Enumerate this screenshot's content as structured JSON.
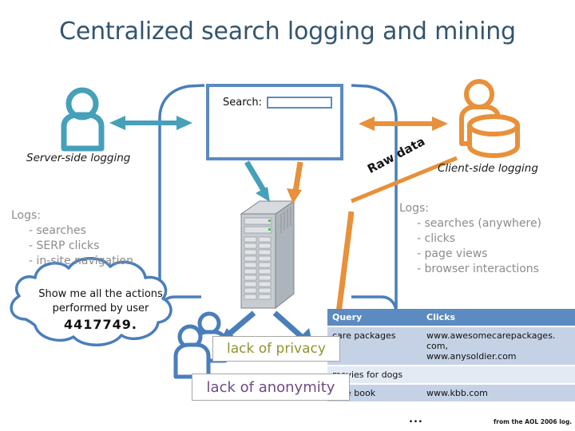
{
  "page": {
    "title": "Centralized search logging and mining",
    "background": "#ffffff",
    "title_color": "#33546e"
  },
  "browser": {
    "search_label": "Search:",
    "search_value": "",
    "search_placeholder": "",
    "border_color": "#5b8bc0"
  },
  "captions": {
    "server_side": "Server-side logging",
    "client_side": "Client-side logging",
    "raw_data": "Raw data"
  },
  "logs_left": {
    "heading": "Logs:",
    "items": [
      "- searches",
      "- SERP clicks",
      "- in-site navigation"
    ],
    "color": "#8c8c8c"
  },
  "logs_right": {
    "heading": "Logs:",
    "items": [
      "- searches (anywhere)",
      "- clicks",
      "- page views",
      "- browser interactions"
    ],
    "color": "#8c8c8c"
  },
  "thought_bubble": {
    "line1": "Show me all the actions",
    "line2": "performed by user",
    "line3": "4417749."
  },
  "callouts": {
    "privacy": {
      "label": "lack of privacy",
      "color": "#8f9430"
    },
    "anonymity": {
      "label": "lack of anonymity",
      "color": "#6f4a87"
    }
  },
  "table": {
    "headers": [
      "Query",
      "Clicks"
    ],
    "rows": [
      {
        "query": "care packages",
        "clicks": "www.awesomecarepackages.\ncom,\nwww.anysoldier.com"
      },
      {
        "query": "movies for dogs",
        "clicks": ""
      },
      {
        "query": "blue book",
        "clicks": "www.kbb.com"
      }
    ],
    "ellipsis": "...",
    "header_bg": "#5b8bc0",
    "row_alt_bg": "#c5d2e6"
  },
  "credit": "from the AOL 2006 log.",
  "icons": {
    "user_left": "person-icon",
    "user_right": "person-with-database-icon",
    "server": "server-tower-icon",
    "users_group": "two-people-icon",
    "arrow_left": "double-arrow-icon",
    "arrow_right": "double-arrow-icon"
  },
  "colors": {
    "teal": "#45a0ba",
    "orange": "#e8903a",
    "blue": "#4a7ebb",
    "gray_text": "#8c8c8c"
  }
}
